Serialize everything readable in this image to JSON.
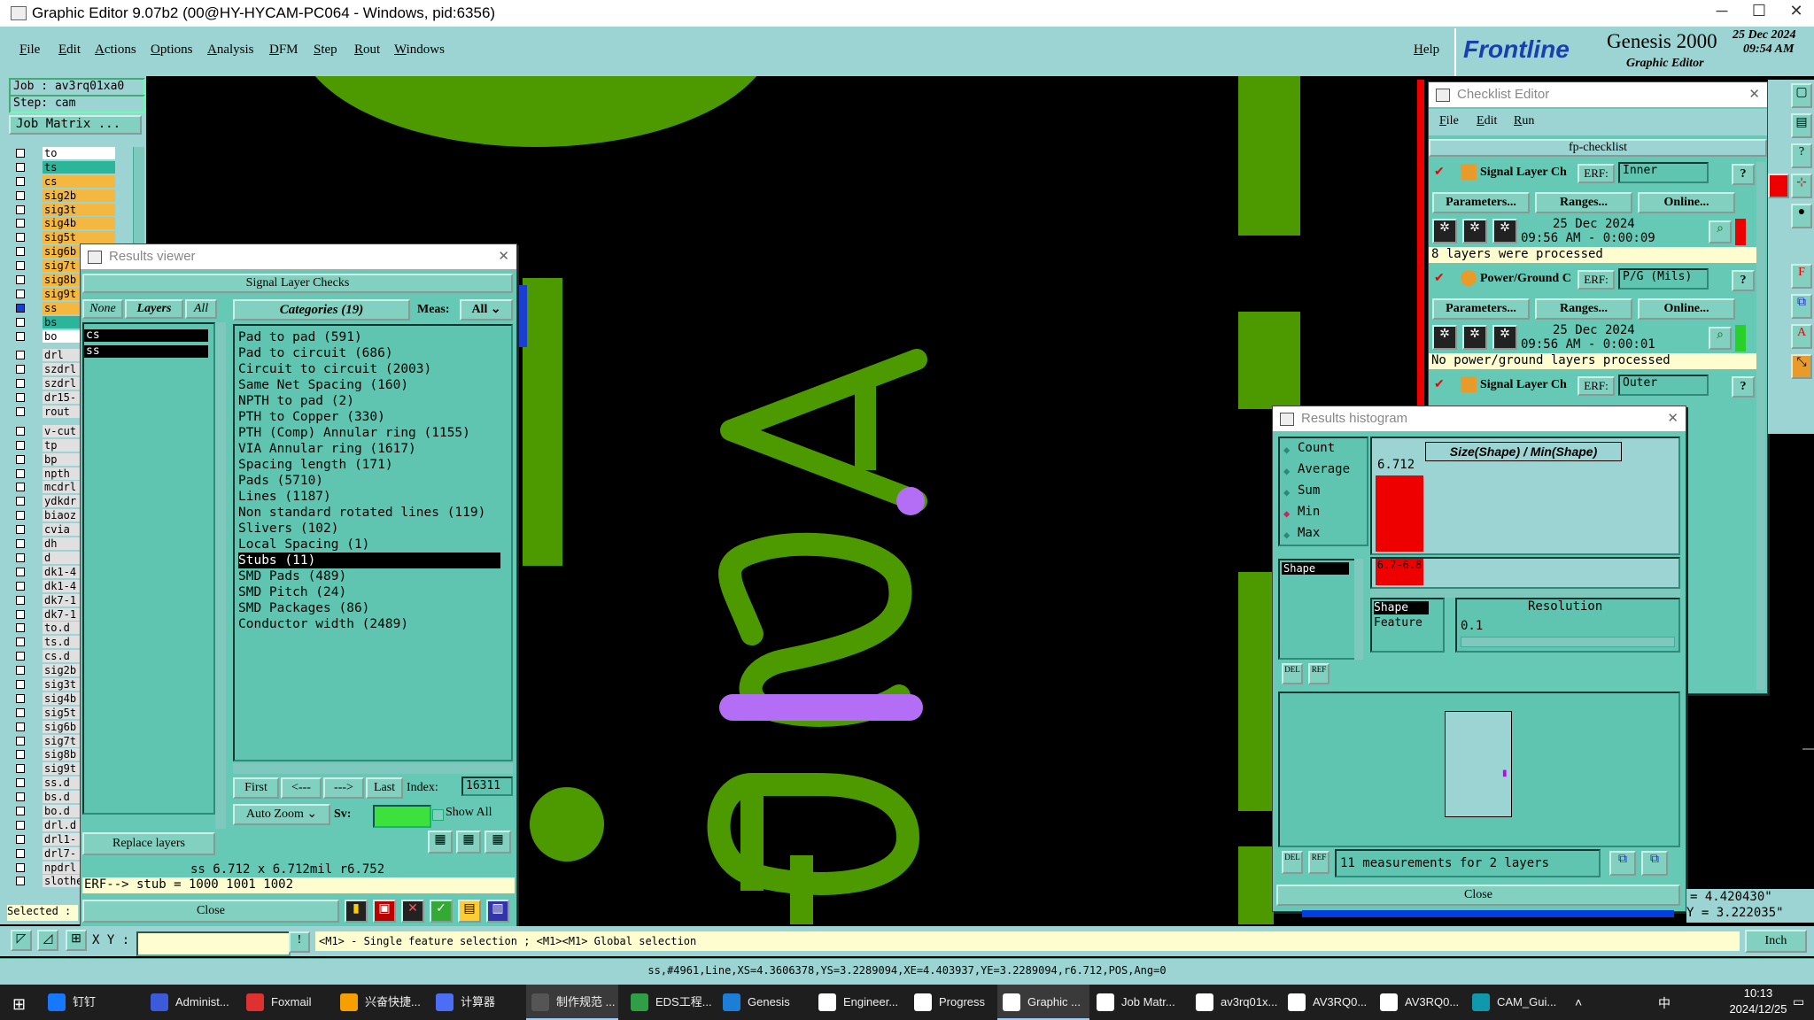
{
  "window": {
    "title": "Graphic Editor 9.07b2 (00@HY-HYCAM-PC064 - Windows, pid:6356)",
    "min": "─",
    "max": "☐",
    "close": "✕"
  },
  "menu": [
    "File",
    "Edit",
    "Actions",
    "Options",
    "Analysis",
    "DFM",
    "Step",
    "Rout",
    "Windows"
  ],
  "help": "Help",
  "brand": {
    "logo": "Frontline",
    "product": "Genesis 2000",
    "sub": "Graphic Editor",
    "date": "25 Dec 2024",
    "time": "09:54 AM"
  },
  "left": {
    "job": "Job : av3rq01xa0",
    "step": "Step: cam",
    "matrix": "Job Matrix ...",
    "selected": "Selected :",
    "layers": [
      {
        "name": "to",
        "c": "#ffffff"
      },
      {
        "name": "ts",
        "c": "#2bb59b"
      },
      {
        "name": "cs",
        "c": "#f4b73f"
      },
      {
        "name": "sig2b",
        "c": "#f4b73f"
      },
      {
        "name": "sig3t",
        "c": "#f4b73f"
      },
      {
        "name": "sig4b",
        "c": "#f4b73f"
      },
      {
        "name": "sig5t",
        "c": "#f4b73f"
      },
      {
        "name": "sig6b",
        "c": "#f4b73f"
      },
      {
        "name": "sig7t",
        "c": "#f4b73f"
      },
      {
        "name": "sig8b",
        "c": "#f4b73f"
      },
      {
        "name": "sig9t",
        "c": "#f4b73f"
      },
      {
        "name": "ss",
        "c": "#f4b73f"
      },
      {
        "name": "bs",
        "c": "#2bb59b"
      },
      {
        "name": "bo",
        "c": "#ffffff"
      },
      {
        "name": "drl",
        "c": "#e0e0e0"
      },
      {
        "name": "szdrl",
        "c": "#e0e0e0"
      },
      {
        "name": "szdrl",
        "c": "#e0e0e0"
      },
      {
        "name": "dr15-",
        "c": "#e0e0e0"
      },
      {
        "name": "rout",
        "c": "#e0e0e0"
      },
      {
        "name": "v-cut",
        "c": "#e0e0e0"
      },
      {
        "name": "tp",
        "c": "#e0e0e0"
      },
      {
        "name": "bp",
        "c": "#e0e0e0"
      },
      {
        "name": "npth",
        "c": "#e0e0e0"
      },
      {
        "name": "mcdrl",
        "c": "#e0e0e0"
      },
      {
        "name": "ydkdr",
        "c": "#e0e0e0"
      },
      {
        "name": "biaoz",
        "c": "#e0e0e0"
      },
      {
        "name": "cvia",
        "c": "#e0e0e0"
      },
      {
        "name": "dh",
        "c": "#e0e0e0"
      },
      {
        "name": "d",
        "c": "#e0e0e0"
      },
      {
        "name": "dk1-4",
        "c": "#e0e0e0"
      },
      {
        "name": "dk1-4",
        "c": "#e0e0e0"
      },
      {
        "name": "dk7-1",
        "c": "#e0e0e0"
      },
      {
        "name": "dk7-1",
        "c": "#e0e0e0"
      },
      {
        "name": "to.d",
        "c": "#e0e0e0"
      },
      {
        "name": "ts.d",
        "c": "#e0e0e0"
      },
      {
        "name": "cs.d",
        "c": "#e0e0e0"
      },
      {
        "name": "sig2b",
        "c": "#e0e0e0"
      },
      {
        "name": "sig3t",
        "c": "#e0e0e0"
      },
      {
        "name": "sig4b",
        "c": "#e0e0e0"
      },
      {
        "name": "sig5t",
        "c": "#e0e0e0"
      },
      {
        "name": "sig6b",
        "c": "#e0e0e0"
      },
      {
        "name": "sig7t",
        "c": "#e0e0e0"
      },
      {
        "name": "sig8b",
        "c": "#e0e0e0"
      },
      {
        "name": "sig9t",
        "c": "#e0e0e0"
      },
      {
        "name": "ss.d",
        "c": "#e0e0e0"
      },
      {
        "name": "bs.d",
        "c": "#e0e0e0"
      },
      {
        "name": "bo.d",
        "c": "#e0e0e0"
      },
      {
        "name": "drl.d",
        "c": "#e0e0e0"
      },
      {
        "name": "drl1-",
        "c": "#e0e0e0"
      },
      {
        "name": "drl7-",
        "c": "#e0e0e0"
      },
      {
        "name": "npdrl",
        "c": "#e0e0e0"
      },
      {
        "name": "slothe",
        "c": "#e0e0e0"
      }
    ]
  },
  "results": {
    "title": "Results viewer",
    "header": "Signal Layer Checks",
    "none": "None",
    "layers": "Layers",
    "all": "All",
    "categories": "Categories (19)",
    "meas_label": "Meas:",
    "meas_val": "All",
    "layer_list": [
      "cs",
      "ss"
    ],
    "cats": [
      "Pad to pad (591)",
      "Pad to circuit (686)",
      "Circuit to circuit (2003)",
      "Same Net Spacing (160)",
      "NPTH to pad (2)",
      "PTH to Copper (330)",
      "PTH (Comp) Annular ring (1155)",
      "VIA Annular ring (1617)",
      "Spacing length (171)",
      "Pads (5710)",
      "Lines (1187)",
      "Non standard rotated lines (119)",
      "Slivers (102)",
      "Local Spacing (1)",
      "Stubs (11)",
      "SMD Pads (489)",
      "SMD Pitch (24)",
      "SMD Packages (86)",
      "Conductor width (2489)"
    ],
    "first": "First",
    "prev": "<---",
    "next": "--->",
    "last": "Last",
    "index_label": "Index:",
    "index_val": "16311",
    "replace": "Replace layers",
    "autozoom": "Auto Zoom",
    "sv": "Sv:",
    "showall": "Show All",
    "info": "ss 6.712 x 6.712mil  r6.752",
    "erf": "ERF--> stub = 1000 1001 1002",
    "close": "Close"
  },
  "checklist": {
    "title": "Checklist Editor",
    "menu": [
      "File",
      "Edit",
      "Run"
    ],
    "name": "fp-checklist",
    "items": [
      {
        "name": "Signal Layer Ch",
        "erf": "ERF:",
        "erfval": "Inner",
        "date": "25 Dec 2024",
        "time": "09:56 AM - 0:00:09",
        "msg": "8 layers were processed",
        "flag": "#e00000"
      },
      {
        "name": "Power/Ground C",
        "erf": "ERF:",
        "erfval": "P/G (Mils)",
        "date": "25 Dec 2024",
        "time": "09:56 AM - 0:00:01",
        "msg": "No power/ground layers processed",
        "flag": "#2ad02a"
      },
      {
        "name": "Signal Layer Ch",
        "erf": "ERF:",
        "erfval": "Outer"
      }
    ],
    "params": "Parameters...",
    "ranges": "Ranges...",
    "online": "Online..."
  },
  "histogram": {
    "title": "Results histogram",
    "modes": [
      "Count",
      "Average",
      "Sum",
      "Min",
      "Max"
    ],
    "selected_mode": "Min",
    "chart_title": "Size(Shape) / Min(Shape)",
    "bar_value": "6.712",
    "bar_label": "6.7-6.8",
    "list": [
      "Shape"
    ],
    "shape": "Shape",
    "feature": "Feature",
    "resolution": "Resolution",
    "res_val": "0.1",
    "summary": "11 measurements for 2 layers",
    "close": "Close"
  },
  "chart_data": {
    "type": "bar",
    "title": "Size(Shape) / Min(Shape)",
    "categories": [
      "6.7-6.8"
    ],
    "values": [
      6.712
    ]
  },
  "coords": {
    "x": "= 4.420430\"",
    "y": "Y = 3.222035\""
  },
  "status": {
    "xy": "X Y :",
    "hint": "<M1> - Single feature selection ; <M1><M1> Global selection",
    "unit": "Inch",
    "feature": "ss,#4961,Line,XS=4.3606378,YS=3.2289094,XE=4.403937,YE=3.2289094,r6.712,POS,Ang=0"
  },
  "taskbar": {
    "apps": [
      "钉钉",
      "Administ...",
      "Foxmail",
      "兴奋快捷...",
      "计算器",
      "制作规范 ...",
      "EDS工程...",
      "Genesis",
      "Engineer...",
      "Progress",
      "Graphic ...",
      "Job Matr...",
      "av3rq01x...",
      "AV3RQ0...",
      "AV3RQ0...",
      "CAM_Gui..."
    ],
    "time": "10:13",
    "date": "2024/12/25",
    "tray": "中"
  }
}
